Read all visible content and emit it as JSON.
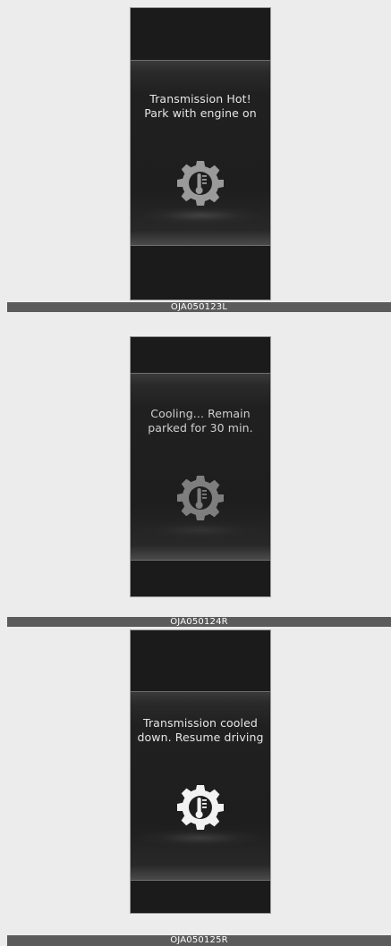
{
  "panels": [
    {
      "message_line1": "Transmission Hot!",
      "message_line2": "Park with engine on",
      "caption": "OJA050123L",
      "icon": "transmission-temperature-gear-icon",
      "icon_color": "#9a9a9a"
    },
    {
      "message_line1": "Cooling... Remain",
      "message_line2": "parked for 30 min.",
      "caption": "OJA050124R",
      "icon": "transmission-temperature-gear-icon",
      "icon_color": "#7e7e7e"
    },
    {
      "message_line1": "Transmission cooled",
      "message_line2": "down. Resume driving",
      "caption": "OJA050125R",
      "icon": "transmission-temperature-gear-icon",
      "icon_color": "#f2f2f2"
    }
  ]
}
